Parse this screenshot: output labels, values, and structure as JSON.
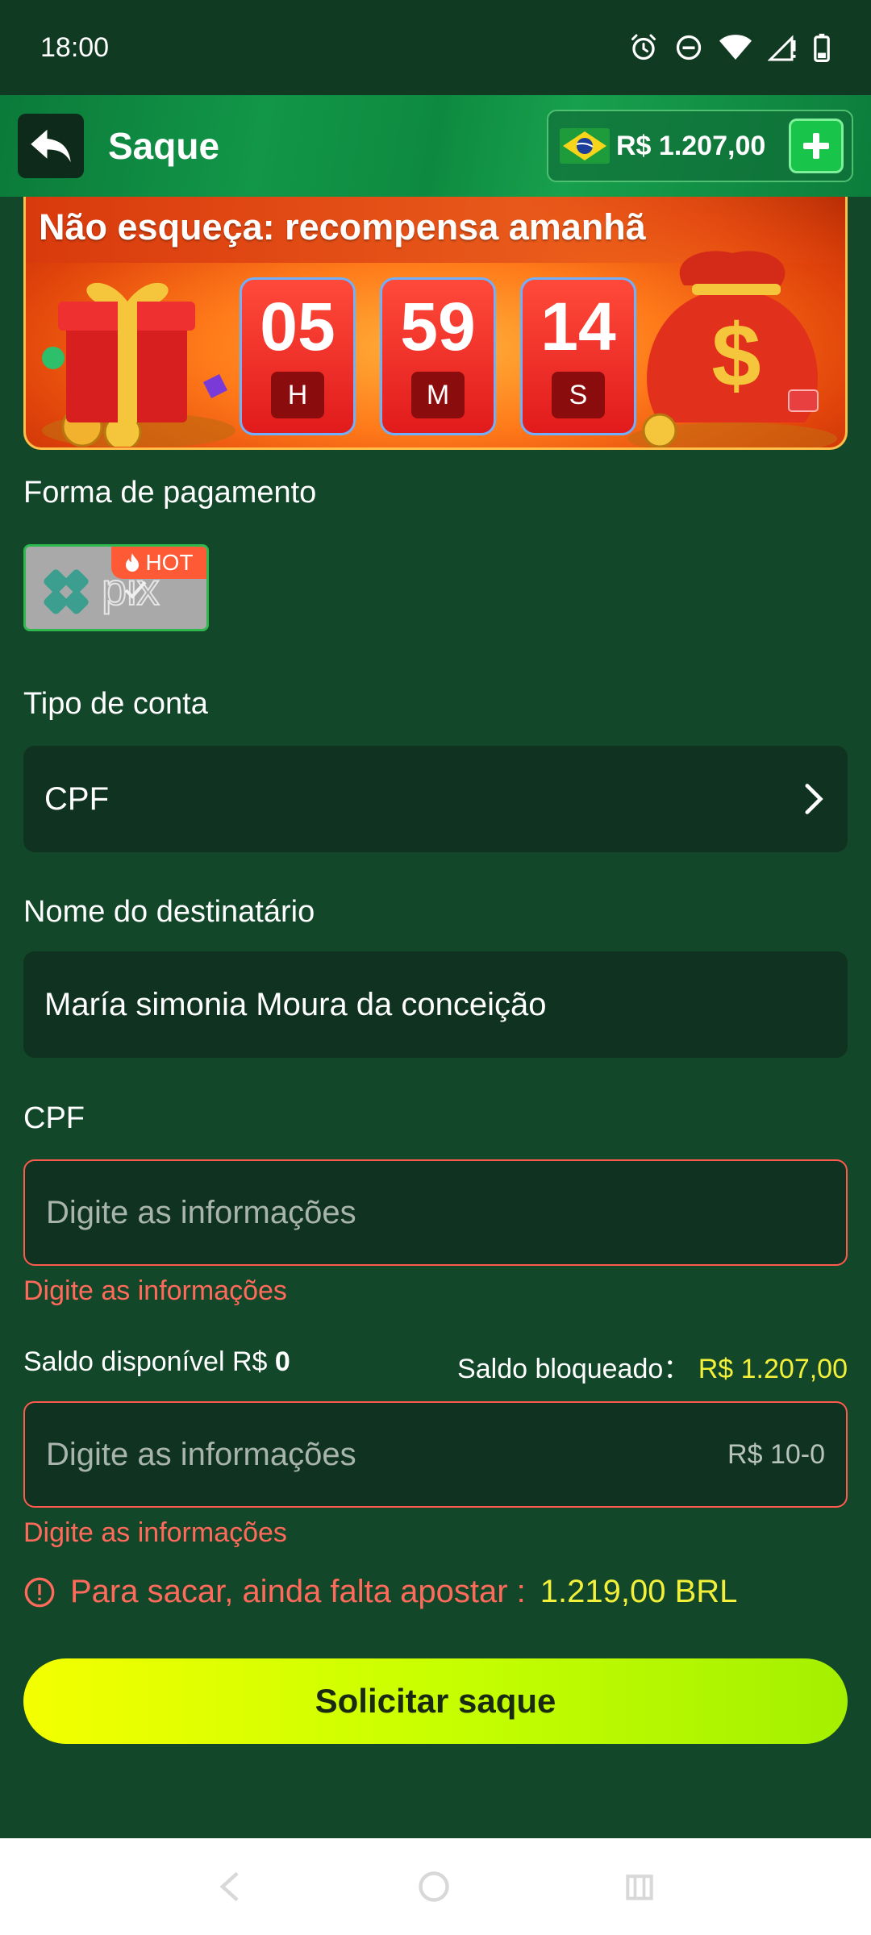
{
  "status": {
    "time": "18:00"
  },
  "header": {
    "title": "Saque",
    "balance": "R$ 1.207,00"
  },
  "promo": {
    "title": "Não esqueça: recompensa amanhã",
    "countdown": [
      {
        "value": "05",
        "unit": "H"
      },
      {
        "value": "59",
        "unit": "M"
      },
      {
        "value": "14",
        "unit": "S"
      }
    ]
  },
  "payment": {
    "label": "Forma de pagamento",
    "method": "pix",
    "badge": "HOT"
  },
  "account_type": {
    "label": "Tipo de conta",
    "value": "CPF"
  },
  "recipient": {
    "label": "Nome do destinatário",
    "value": "María simonia Moura da conceição"
  },
  "cpf": {
    "label": "CPF",
    "placeholder": "Digite as informações",
    "error": "Digite as informações"
  },
  "balances": {
    "available_label": "Saldo disponível R$",
    "available_value": "0",
    "blocked_label": "Saldo bloqueado：",
    "blocked_value": "R$ 1.207,00"
  },
  "amount": {
    "placeholder": "Digite as informações",
    "range_hint": "R$ 10-0",
    "error": "Digite as informações"
  },
  "warning": {
    "text": "Para sacar, ainda falta apostar :",
    "amount": "1.219,00 BRL"
  },
  "submit": {
    "label": "Solicitar saque"
  },
  "colors": {
    "background": "#12472a",
    "header": "#129648",
    "accent_yellow": "#f3f03a",
    "error_red": "#ff5a4e",
    "button_gradient_start": "#f4ff00"
  }
}
